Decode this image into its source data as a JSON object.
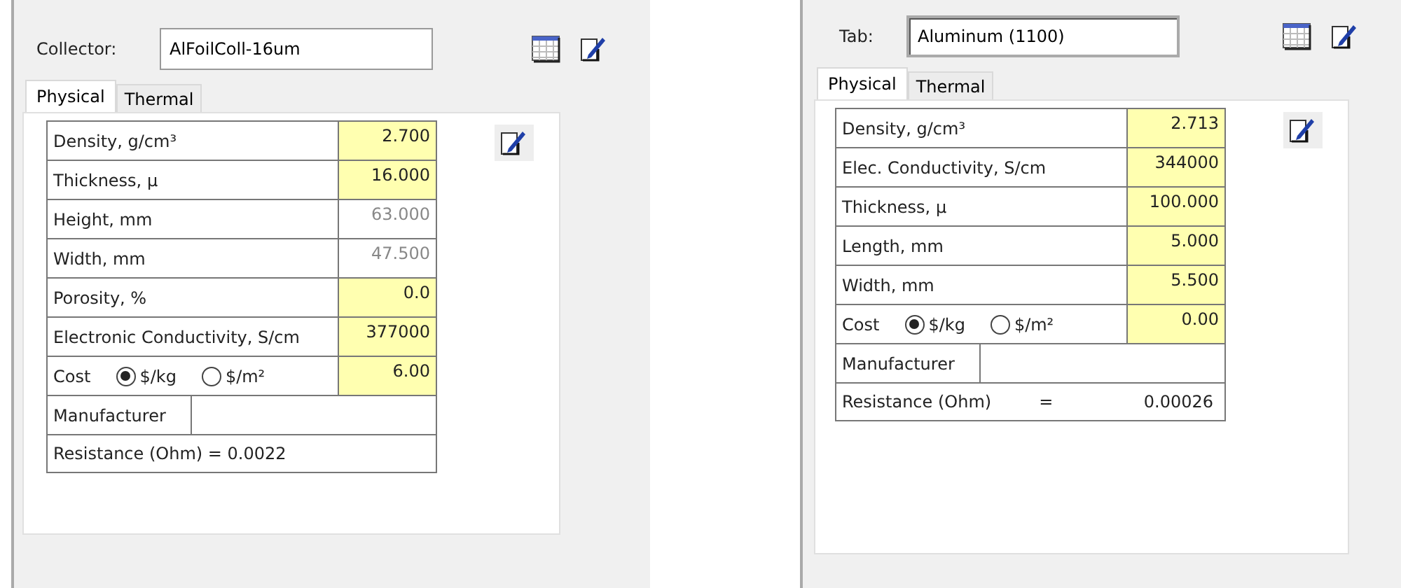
{
  "panels": [
    {
      "label": "Collector:",
      "value": "AlFoilColl-16um",
      "tabs": [
        {
          "label": "Physical",
          "selected": true
        },
        {
          "label": "Thermal",
          "selected": false
        }
      ],
      "rows": [
        {
          "kind": "value",
          "label": "Density, g/cm³",
          "value": "2.700",
          "editable": true
        },
        {
          "kind": "value",
          "label": "Thickness, µ",
          "value": "16.000",
          "editable": true
        },
        {
          "kind": "value",
          "label": "Height, mm",
          "value": "63.000",
          "editable": false
        },
        {
          "kind": "value",
          "label": "Width, mm",
          "value": "47.500",
          "editable": false
        },
        {
          "kind": "value",
          "label": "Porosity, %",
          "value": "0.0",
          "editable": true
        },
        {
          "kind": "value",
          "label": "Electronic Conductivity, S/cm",
          "value": "377000",
          "editable": true
        },
        {
          "kind": "cost",
          "label": "Cost",
          "options": [
            {
              "label": "$/kg",
              "selected": true
            },
            {
              "label": "$/m²",
              "selected": false
            }
          ],
          "value": "6.00",
          "editable": true
        },
        {
          "kind": "manufacturer",
          "label": "Manufacturer"
        },
        {
          "kind": "resistance",
          "text": "Resistance (Ohm) = 0.0022"
        }
      ]
    },
    {
      "label": "Tab:",
      "value": "Aluminum (1100)",
      "tabs": [
        {
          "label": "Physical",
          "selected": true
        },
        {
          "label": "Thermal",
          "selected": false
        }
      ],
      "rows": [
        {
          "kind": "value",
          "label": "Density, g/cm³",
          "value": "2.713",
          "editable": true
        },
        {
          "kind": "value",
          "label": "Elec. Conductivity, S/cm",
          "value": "344000",
          "editable": true
        },
        {
          "kind": "value",
          "label": "Thickness, µ",
          "value": "100.000",
          "editable": true
        },
        {
          "kind": "value",
          "label": "Length, mm",
          "value": "5.000",
          "editable": true
        },
        {
          "kind": "value",
          "label": "Width, mm",
          "value": "5.500",
          "editable": true
        },
        {
          "kind": "cost",
          "label": "Cost",
          "options": [
            {
              "label": "$/kg",
              "selected": true
            },
            {
              "label": "$/m²",
              "selected": false
            }
          ],
          "value": "0.00",
          "editable": true
        },
        {
          "kind": "manufacturer",
          "label": "Manufacturer"
        },
        {
          "kind": "resistance_split",
          "label": "Resistance (Ohm)",
          "sign": "=",
          "value": "0.00026"
        }
      ]
    }
  ]
}
